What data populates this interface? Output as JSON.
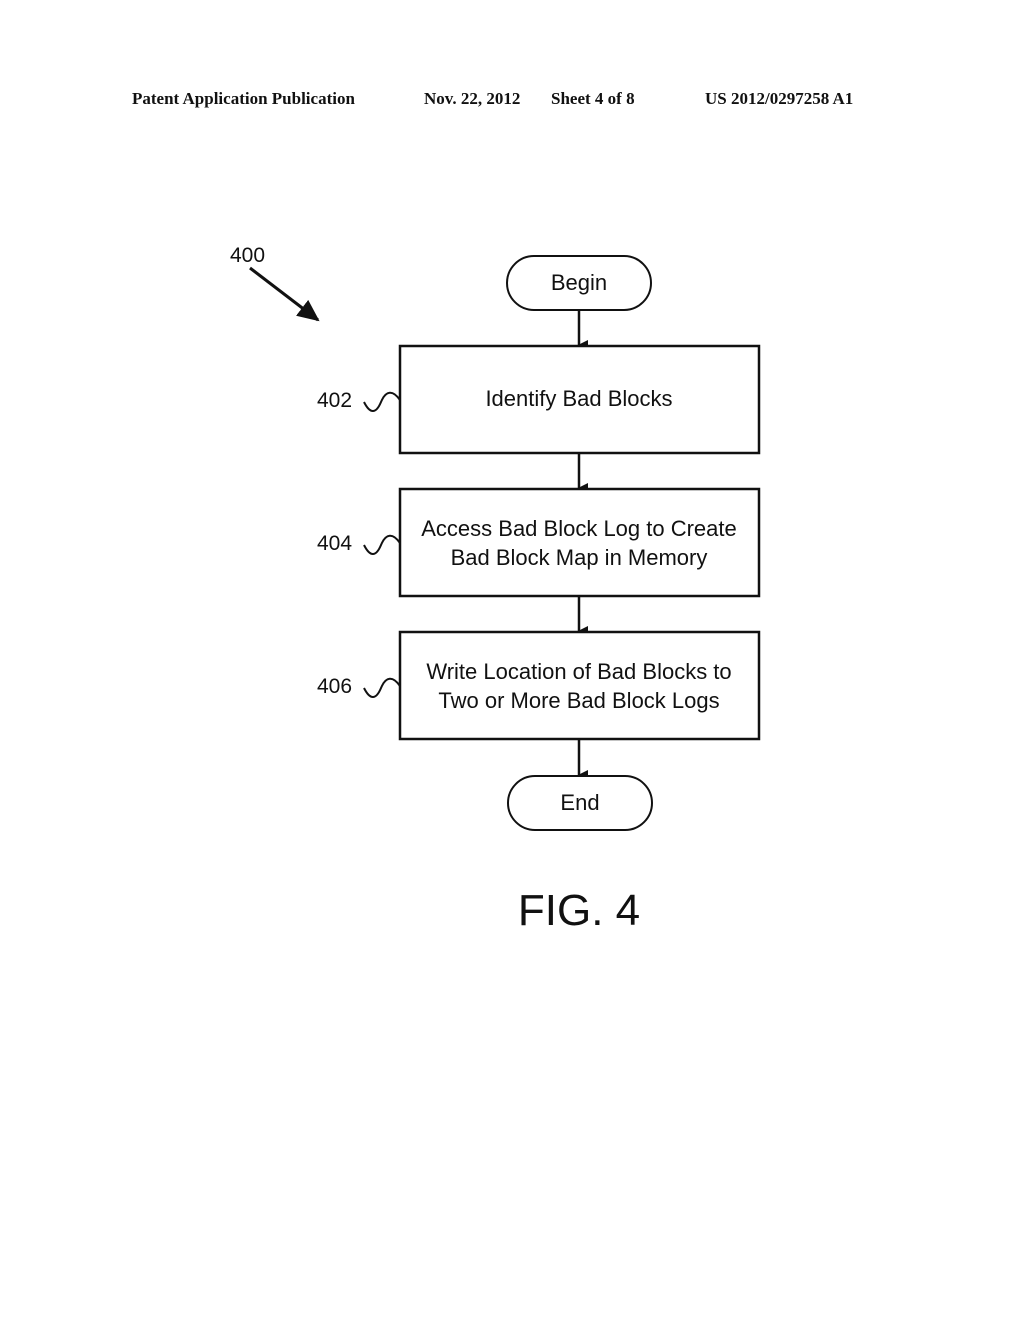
{
  "header": {
    "publication": "Patent Application Publication",
    "date": "Nov. 22, 2012",
    "sheet": "Sheet 4 of 8",
    "number": "US 2012/0297258 A1"
  },
  "diagram": {
    "ref_main": "400",
    "begin": "Begin",
    "end": "End",
    "steps": [
      {
        "ref": "402",
        "lines": [
          "Identify Bad Blocks"
        ]
      },
      {
        "ref": "404",
        "lines": [
          "Access Bad Block Log to Create",
          "Bad Block Map in Memory"
        ]
      },
      {
        "ref": "406",
        "lines": [
          "Write Location of Bad Blocks to",
          "Two or More Bad Block Logs"
        ]
      }
    ],
    "figure_label": "FIG. 4"
  }
}
